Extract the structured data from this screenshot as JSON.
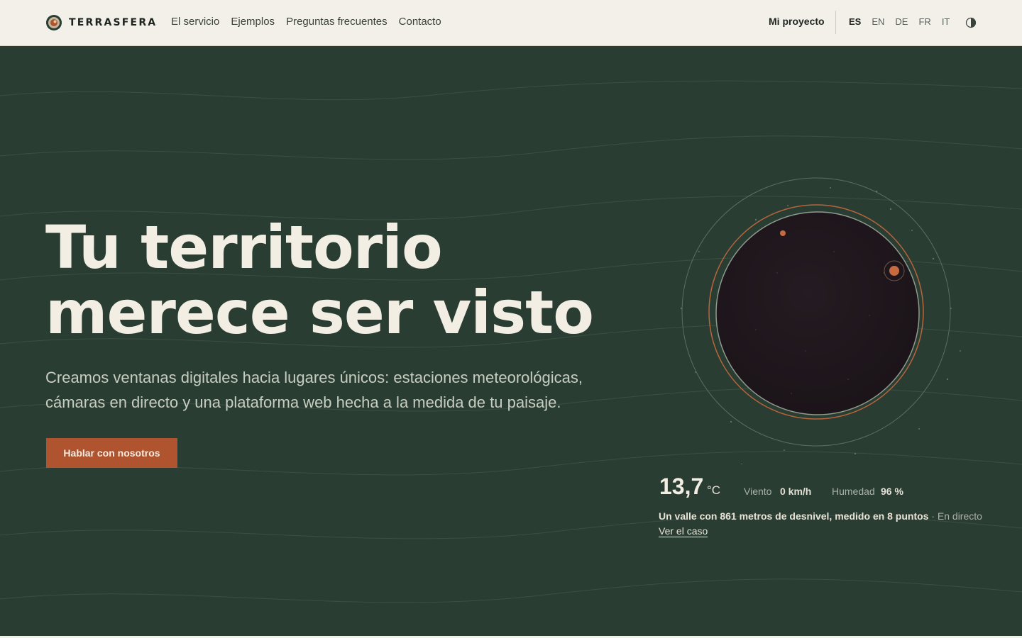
{
  "header": {
    "brand": "TERRASFERA",
    "nav": [
      "El servicio",
      "Ejemplos",
      "Preguntas frecuentes",
      "Contacto"
    ],
    "project_link": "Mi proyecto",
    "languages": [
      "ES",
      "EN",
      "DE",
      "FR",
      "IT"
    ],
    "active_language": "ES"
  },
  "hero": {
    "title_line1": "Tu territorio",
    "title_line2": "merece ser visto",
    "subtitle_line1": "Creamos ventanas digitales hacia lugares únicos: estaciones meteorológicas,",
    "subtitle_line2": "cámaras en directo y una plataforma web hecha a la medida de tu paisaje.",
    "cta_label": "Hablar con nosotros"
  },
  "weather": {
    "temperature": "13,7",
    "temperature_unit": "°C",
    "wind_label": "Viento",
    "wind_value": "0 km/h",
    "humidity_label": "Humedad",
    "humidity_value": "96 %",
    "caption": "Un valle con 861 metros de desnivel, medido en 8 puntos",
    "live_label": " · En directo",
    "case_link": "Ver el caso"
  },
  "colors": {
    "hero_background": "#2a3d32",
    "accent": "#b0532f",
    "header_background": "#f3f0e9"
  },
  "icons": [
    "terrasfera-logo-icon",
    "contrast-toggle-icon",
    "globe-illustration"
  ]
}
